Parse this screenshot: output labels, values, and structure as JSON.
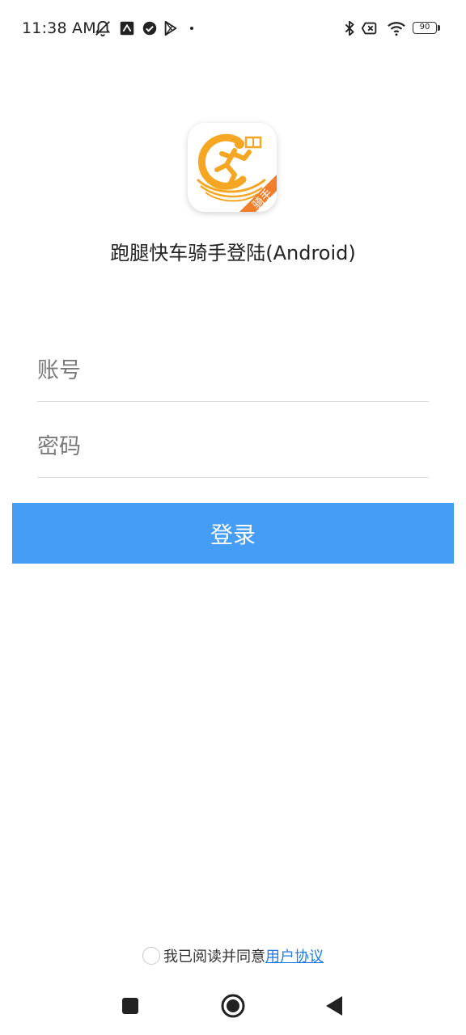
{
  "status_bar": {
    "time": "11:38 AM",
    "battery": "90",
    "icons": [
      "muted-alarm-icon",
      "nfc-icon",
      "check-circle-icon",
      "play-store-icon",
      "bluetooth-icon",
      "no-sim-icon",
      "wifi-icon",
      "battery-icon"
    ]
  },
  "app": {
    "title": "跑腿快车骑手登陆(Android)",
    "logo_badge": "骑手",
    "logo_colors": {
      "orange": "#f5a623",
      "badge": "#f07e2b"
    }
  },
  "form": {
    "account_placeholder": "账号",
    "password_placeholder": "密码",
    "login_label": "登录",
    "login_color": "#459df5"
  },
  "agreement": {
    "prefix": "我已阅读并同意",
    "link": "用户协议",
    "link_color": "#1e7be8"
  },
  "nav": {
    "icons": [
      "recents-icon",
      "home-icon",
      "back-icon"
    ]
  }
}
